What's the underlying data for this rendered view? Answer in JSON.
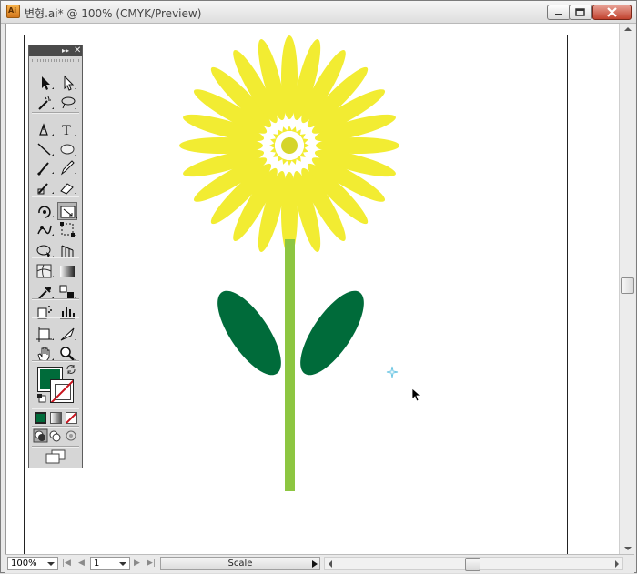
{
  "window": {
    "title": "변형.ai* @ 100% (CMYK/Preview)",
    "app_icon_text": "Ai"
  },
  "colors": {
    "petal": "#f2ec32",
    "flower_center": "#d5d52a",
    "stem": "#8dc641",
    "leaf": "#006b3a",
    "fill_swatch": "#006b3a",
    "stroke_none_slash": "#c8141e",
    "anchor_point": "#6dc6e3"
  },
  "statusbar": {
    "zoom": "100%",
    "page": "1",
    "status": "Scale"
  },
  "toolbox": {
    "tools": [
      "selection-tool",
      "direct-selection-tool",
      "magic-wand-tool",
      "lasso-tool",
      "pen-tool",
      "type-tool",
      "line-segment-tool",
      "ellipse-tool",
      "paintbrush-tool",
      "pencil-tool",
      "blob-brush-tool",
      "eraser-tool",
      "rotate-tool",
      "scale-tool",
      "warp-tool",
      "free-transform-tool",
      "shape-builder-tool",
      "perspective-grid-tool",
      "mesh-tool",
      "gradient-tool",
      "eyedropper-tool",
      "blend-tool",
      "symbol-sprayer-tool",
      "column-graph-tool",
      "artboard-tool",
      "slice-tool",
      "hand-tool",
      "zoom-tool"
    ],
    "active_tool": "scale-tool"
  }
}
